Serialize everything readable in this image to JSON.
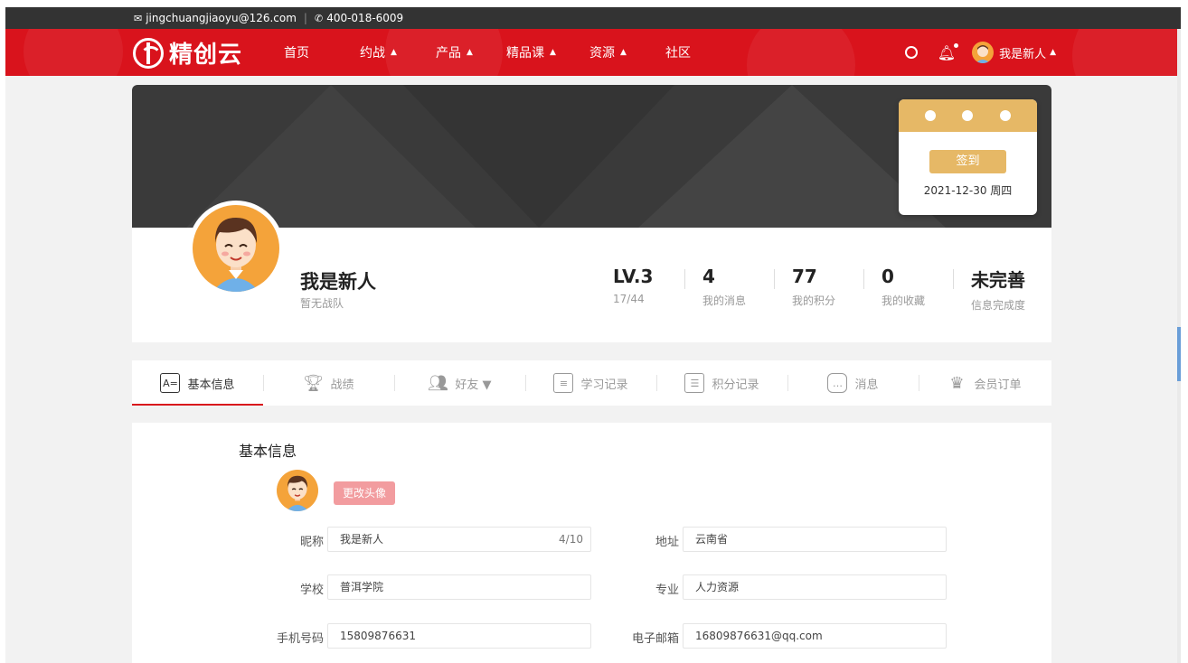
{
  "topbar": {
    "email": "jingchuangjiaoyu@126.com",
    "phone": "400-018-6009",
    "email_icon": "mail-icon",
    "phone_icon": "phone-icon"
  },
  "nav": {
    "logo_text": "精创云",
    "items": [
      {
        "label": "首页",
        "has_caret": false
      },
      {
        "label": "约战",
        "has_caret": true
      },
      {
        "label": "产品",
        "has_caret": true
      },
      {
        "label": "精品课",
        "has_caret": true
      },
      {
        "label": "资源",
        "has_caret": true
      },
      {
        "label": "社区",
        "has_caret": false
      }
    ],
    "user_name": "我是新人",
    "brand_color": "#d9131c"
  },
  "calendar": {
    "sign_label": "签到",
    "date": "2021-12-30 周四"
  },
  "profile": {
    "name": "我是新人",
    "team": "暂无战队",
    "stats": [
      {
        "value": "LV.3",
        "label": "17/44"
      },
      {
        "value": "4",
        "label": "我的消息"
      },
      {
        "value": "77",
        "label": "我的积分"
      },
      {
        "value": "0",
        "label": "我的收藏"
      },
      {
        "value": "未完善",
        "label": "信息完成度"
      }
    ]
  },
  "tabs": [
    {
      "label": "基本信息",
      "icon": "id-card-icon",
      "active": true
    },
    {
      "label": "战绩",
      "icon": "trophy-icon",
      "active": false
    },
    {
      "label": "好友 ▼",
      "icon": "friends-icon",
      "active": false
    },
    {
      "label": "学习记录",
      "icon": "study-record-icon",
      "active": false
    },
    {
      "label": "积分记录",
      "icon": "points-record-icon",
      "active": false
    },
    {
      "label": "消息",
      "icon": "message-icon",
      "active": false
    },
    {
      "label": "会员订单",
      "icon": "crown-icon",
      "active": false
    }
  ],
  "info": {
    "title": "基本信息",
    "change_avatar_label": "更改头像",
    "fields": {
      "nickname": {
        "label": "昵称",
        "value": "我是新人",
        "count": "4/10"
      },
      "address": {
        "label": "地址",
        "value": "云南省"
      },
      "school": {
        "label": "学校",
        "value": "普洱学院"
      },
      "major": {
        "label": "专业",
        "value": "人力资源"
      },
      "phone": {
        "label": "手机号码",
        "value": "15809876631"
      },
      "email": {
        "label": "电子邮箱",
        "value": "16809876631@qq.com"
      }
    }
  }
}
